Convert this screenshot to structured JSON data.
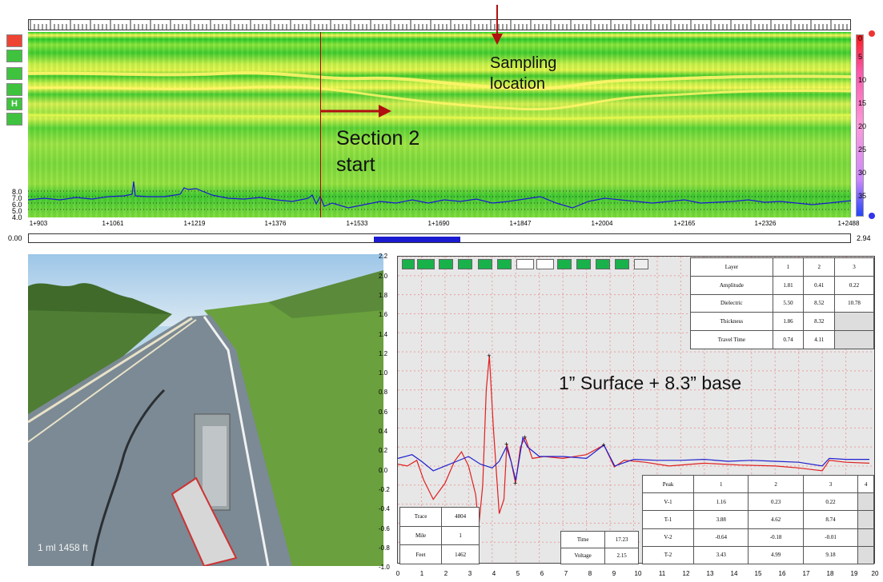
{
  "gpr": {
    "depth_labels": [
      "8.0",
      "7.0",
      "6.0",
      "5.0",
      "4.0"
    ],
    "station_labels": [
      "1+903",
      "1+1061",
      "1+1219",
      "1+1376",
      "1+1533",
      "1+1690",
      "1+1847",
      "1+2004",
      "1+2165",
      "1+2326",
      "1+2488"
    ],
    "colorbar_labels": [
      "0",
      "5",
      "10",
      "15",
      "20",
      "25",
      "30",
      "35"
    ],
    "tools": [
      "",
      "",
      "",
      "",
      "H",
      ""
    ],
    "scroll_min": "0.00",
    "scroll_max": "2.94",
    "scroll_position": 0.42
  },
  "annotations": {
    "sampling": "Sampling location",
    "section": "Section 2 start",
    "layers_note": "1” Surface  + 8.3” base"
  },
  "photo": {
    "caption": "1 ml  1458 ft"
  },
  "waveform": {
    "y_labels": [
      "2.2",
      "2.0",
      "1.8",
      "1.6",
      "1.4",
      "1.2",
      "1.0",
      "0.8",
      "0.6",
      "0.4",
      "0.2",
      "0.0",
      "-0.2",
      "-0.4",
      "-0.6",
      "-0.8",
      "-1.0"
    ],
    "x_labels": [
      "0",
      "1",
      "2",
      "3",
      "4",
      "5",
      "6",
      "7",
      "8",
      "9",
      "10",
      "11",
      "12",
      "13",
      "14",
      "15",
      "16",
      "17",
      "18",
      "19",
      "20"
    ],
    "layer_table": {
      "header": [
        "Layer",
        "1",
        "2",
        "3"
      ],
      "rows": [
        [
          "Amplitude",
          "1.81",
          "0.41",
          "0.22"
        ],
        [
          "Dielectric",
          "5.50",
          "8.52",
          "10.78"
        ],
        [
          "Thickness",
          "1.86",
          "8.32",
          ""
        ],
        [
          "Travel Time",
          "0.74",
          "4.11",
          ""
        ]
      ]
    },
    "peak_table": {
      "header": [
        "Peak",
        "1",
        "2",
        "3",
        "4"
      ],
      "rows": [
        [
          "V-1",
          "1.16",
          "0.23",
          "0.22",
          ""
        ],
        [
          "T-1",
          "3.88",
          "4.62",
          "8.74",
          ""
        ],
        [
          "V-2",
          "-0.64",
          "-0.18",
          "-0.01",
          ""
        ],
        [
          "T-2",
          "3.43",
          "4.99",
          "9.18",
          ""
        ]
      ]
    },
    "trace_table": [
      [
        "Trace",
        "4804"
      ],
      [
        "Mile",
        "1"
      ],
      [
        "Feet",
        "1462"
      ]
    ],
    "time_table": [
      [
        "Time",
        "17.23"
      ],
      [
        "Voltage",
        "2.15"
      ]
    ]
  },
  "colors": {
    "gpr_trace": "#1a1ad0",
    "red_wave": "#e02020",
    "blue_wave": "#2020d0",
    "arrow": "#b01010"
  }
}
